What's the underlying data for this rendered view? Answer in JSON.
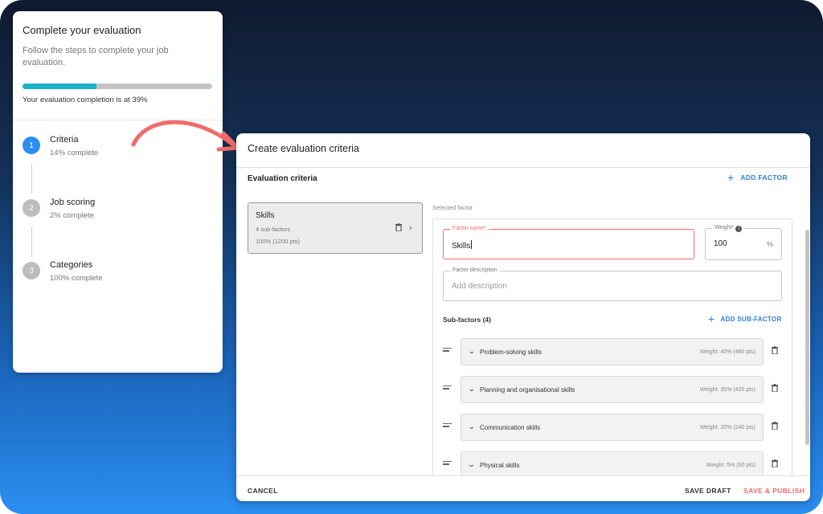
{
  "steps_card": {
    "title": "Complete your evaluation",
    "subtitle": "Follow the steps to complete your job evaluation.",
    "progress": 0.39,
    "progress_text": "Your evaluation completion is at 39%",
    "steps": [
      {
        "number": "1",
        "label": "Criteria",
        "sub": "14% complete",
        "active": true
      },
      {
        "number": "2",
        "label": "Job scoring",
        "sub": "2% complete",
        "active": false
      },
      {
        "number": "3",
        "label": "Categories",
        "sub": "100% complete",
        "active": false
      }
    ]
  },
  "dialog": {
    "title": "Create evaluation criteria",
    "section_title": "Evaluation criteria",
    "add_factor_label": "ADD FACTOR",
    "factor_card": {
      "name": "Skills",
      "subfactors": "4 sub-factors",
      "points": "100% (1200 pts)"
    },
    "selected_label": "Selected factor",
    "factor_name": {
      "label": "Factor name*",
      "value": "Skills"
    },
    "weight": {
      "label": "Weight*",
      "value": "100",
      "unit": "%"
    },
    "description": {
      "label": "Factor description",
      "placeholder": "Add description"
    },
    "subfactors_title": "Sub-factors (4)",
    "add_subfactor_label": "ADD SUB-FACTOR",
    "subfactors": [
      {
        "name": "Problem-solving skills",
        "weight": "Weight: 40% (480 pts)"
      },
      {
        "name": "Planning and organisational skills",
        "weight": "Weight: 35% (420 pts)"
      },
      {
        "name": "Communication skills",
        "weight": "Weight: 20% (240 pts)"
      },
      {
        "name": "Physical skills",
        "weight": "Weight: 5% (60 pts)"
      }
    ],
    "footer": {
      "cancel": "CANCEL",
      "save_draft": "SAVE DRAFT",
      "save_publish": "SAVE & PUBLISH"
    }
  },
  "colors": {
    "accent_blue": "#2b7fe0",
    "progress_fill": "#1ab3c9",
    "error_red": "#f06b6b",
    "arrow": "#f26b6b"
  }
}
